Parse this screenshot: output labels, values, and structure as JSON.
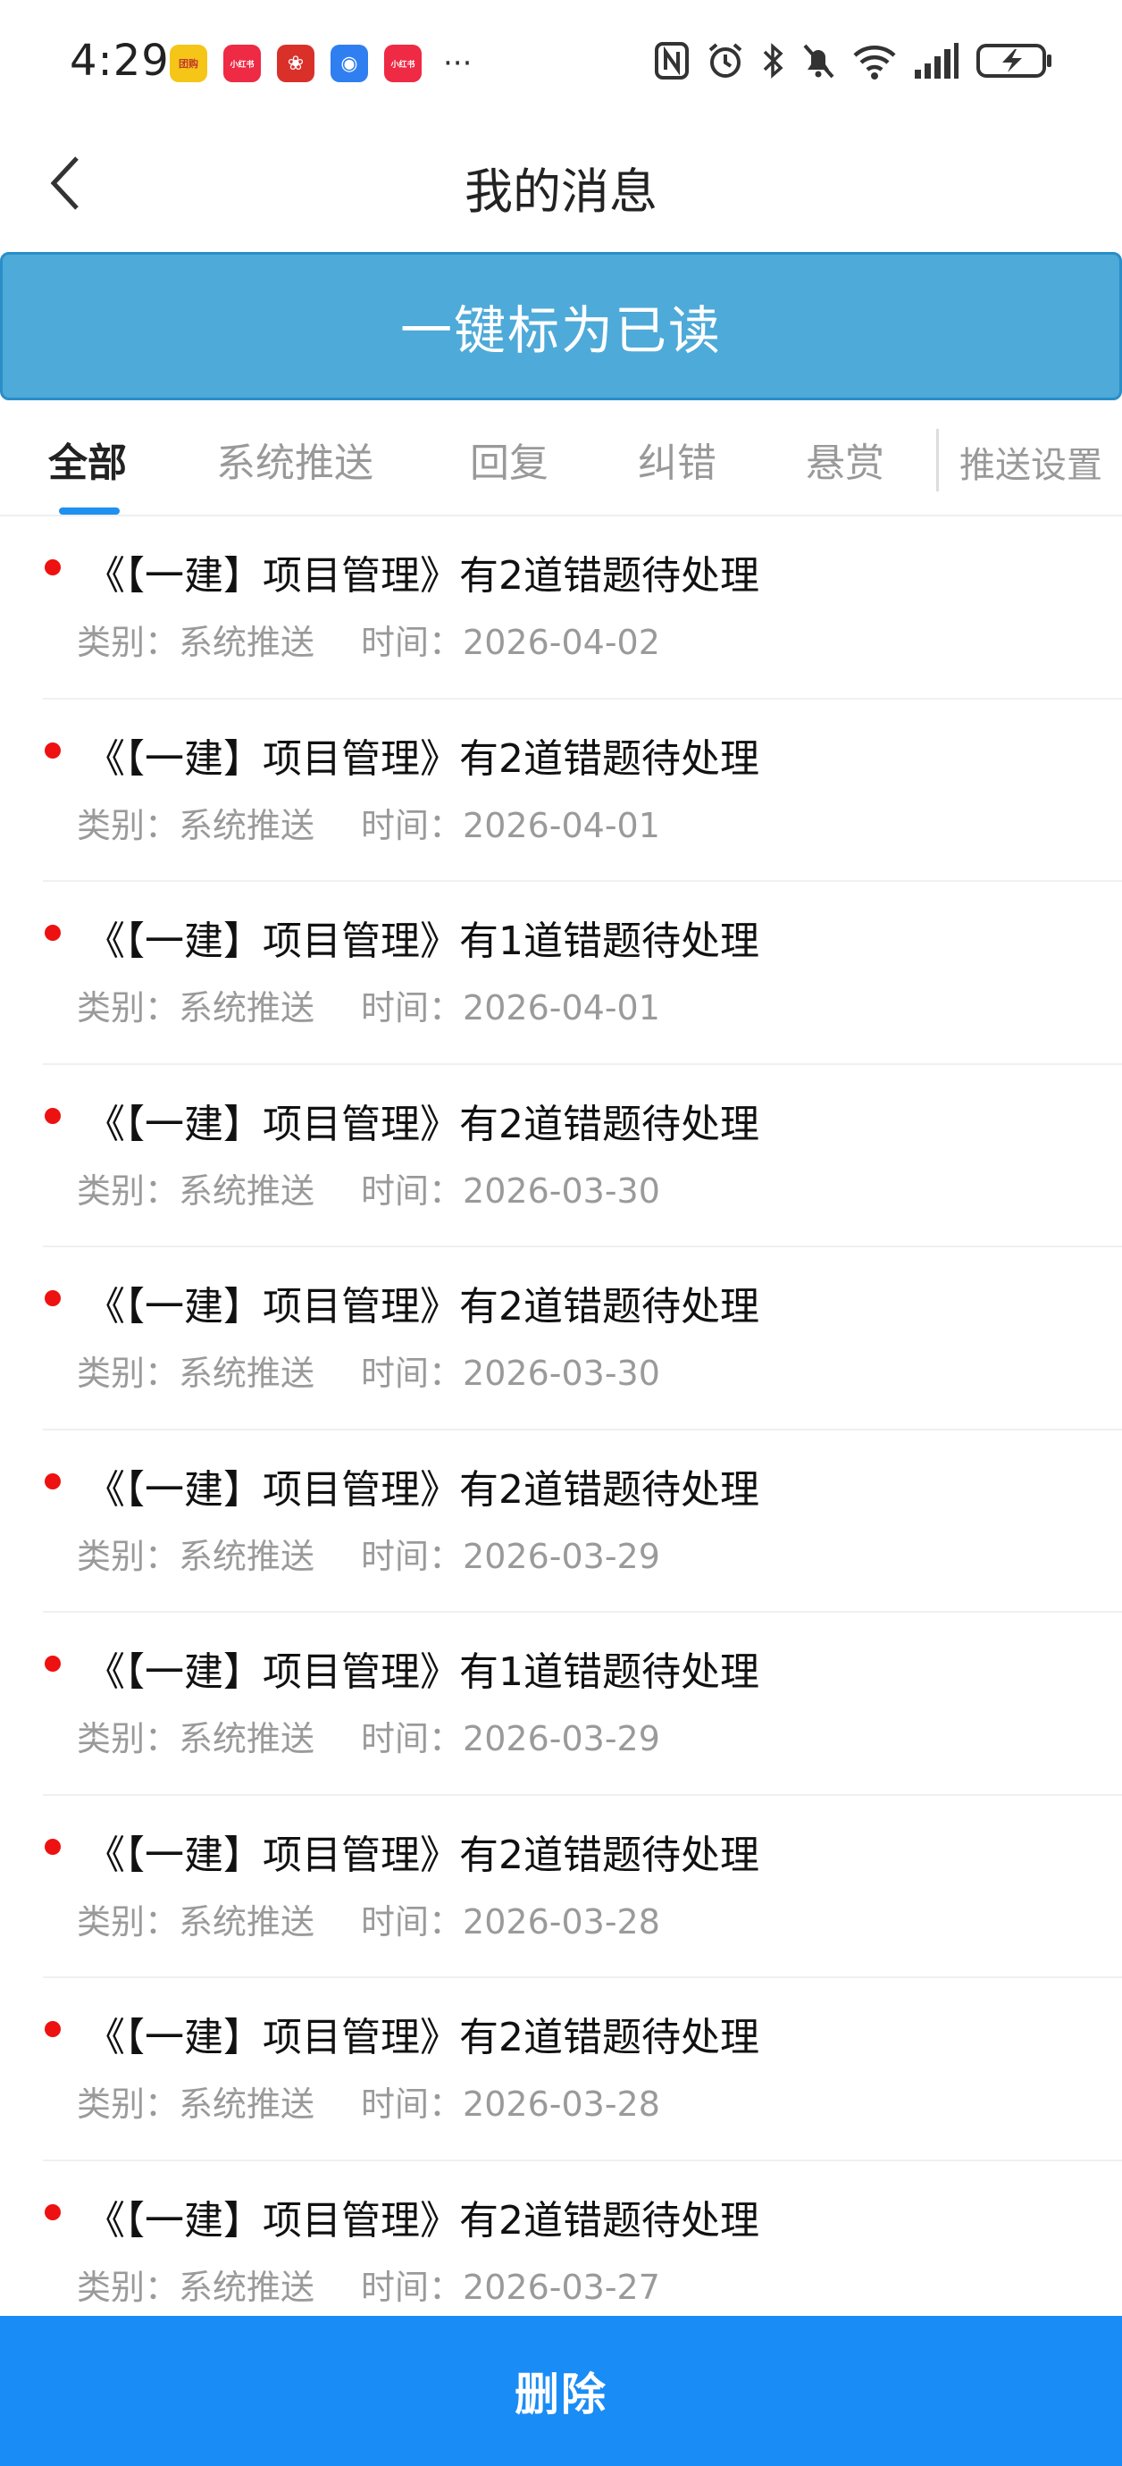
{
  "status_bar": {
    "time": "4:29",
    "app_icons": [
      {
        "name": "tuanhao-app-icon",
        "label": "团购",
        "color": "#f5c518"
      },
      {
        "name": "xiaohongshu-app-icon",
        "label": "小红书",
        "color": "#ee2a44"
      },
      {
        "name": "huawei-app-icon",
        "label": "❀",
        "color": "#d9302a"
      },
      {
        "name": "blue-app-icon",
        "label": "◉",
        "color": "#2f7ff0"
      },
      {
        "name": "xiaohongshu-app-icon-2",
        "label": "小红书",
        "color": "#ee2a44"
      }
    ],
    "more": "···",
    "battery_icon": "battery-charging-icon"
  },
  "header": {
    "title": "我的消息",
    "back_icon": "chevron-left-icon"
  },
  "mark_all_read": "一键标为已读",
  "tabs": [
    {
      "label": "全部",
      "active": true
    },
    {
      "label": "系统推送",
      "active": false
    },
    {
      "label": "回复",
      "active": false
    },
    {
      "label": "纠错",
      "active": false
    },
    {
      "label": "悬赏",
      "active": false
    }
  ],
  "push_settings": "推送设置",
  "meta_labels": {
    "category": "类别：",
    "time": "时间："
  },
  "messages": [
    {
      "title": "《【一建】项目管理》有2道错题待处理",
      "category": "系统推送",
      "time": "2026-04-02"
    },
    {
      "title": "《【一建】项目管理》有2道错题待处理",
      "category": "系统推送",
      "time": "2026-04-01"
    },
    {
      "title": "《【一建】项目管理》有1道错题待处理",
      "category": "系统推送",
      "time": "2026-04-01"
    },
    {
      "title": "《【一建】项目管理》有2道错题待处理",
      "category": "系统推送",
      "time": "2026-03-30"
    },
    {
      "title": "《【一建】项目管理》有2道错题待处理",
      "category": "系统推送",
      "time": "2026-03-30"
    },
    {
      "title": "《【一建】项目管理》有2道错题待处理",
      "category": "系统推送",
      "time": "2026-03-29"
    },
    {
      "title": "《【一建】项目管理》有1道错题待处理",
      "category": "系统推送",
      "time": "2026-03-29"
    },
    {
      "title": "《【一建】项目管理》有2道错题待处理",
      "category": "系统推送",
      "time": "2026-03-28"
    },
    {
      "title": "《【一建】项目管理》有2道错题待处理",
      "category": "系统推送",
      "time": "2026-03-28"
    },
    {
      "title": "《【一建】项目管理》有2道错题待处理",
      "category": "系统推送",
      "time": "2026-03-27"
    }
  ],
  "delete_label": "删除",
  "colors": {
    "accent": "#1a8cf5",
    "banner": "#4eaad8",
    "unread_dot": "#ee1111"
  }
}
